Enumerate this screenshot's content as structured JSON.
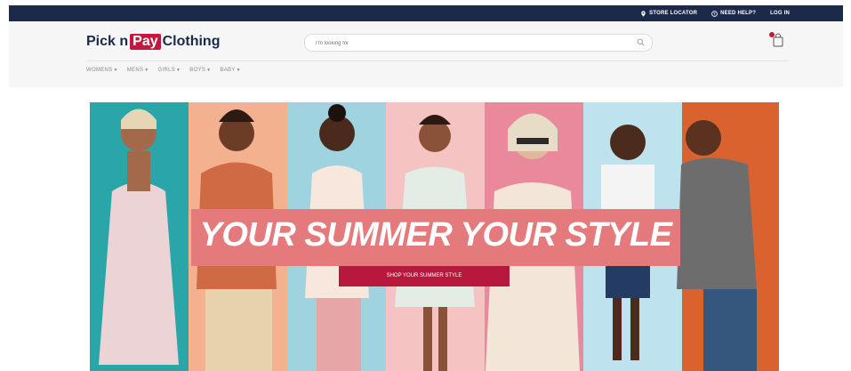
{
  "topbar": {
    "store_locator": "STORE LOCATOR",
    "need_help": "NEED HELP?",
    "login": "LOG IN"
  },
  "logo": {
    "pick": "Pick n",
    "pay": "Pay",
    "clothing": "Clothing"
  },
  "search": {
    "placeholder": "I'm looking for"
  },
  "cart": {
    "icon": "shopping-bag-icon"
  },
  "nav": {
    "items": [
      {
        "label": "WOMENS"
      },
      {
        "label": "MENS"
      },
      {
        "label": "GIRLS"
      },
      {
        "label": "BOYS"
      },
      {
        "label": "BABY"
      }
    ]
  },
  "hero": {
    "headline": "YOUR SUMMER YOUR STYLE",
    "cta": "SHOP YOUR SUMMER STYLE"
  },
  "colors": {
    "topbar": "#1b2a4a",
    "brand_red": "#c4163f",
    "banner": "#e57a7c",
    "cta": "#b8173e"
  }
}
